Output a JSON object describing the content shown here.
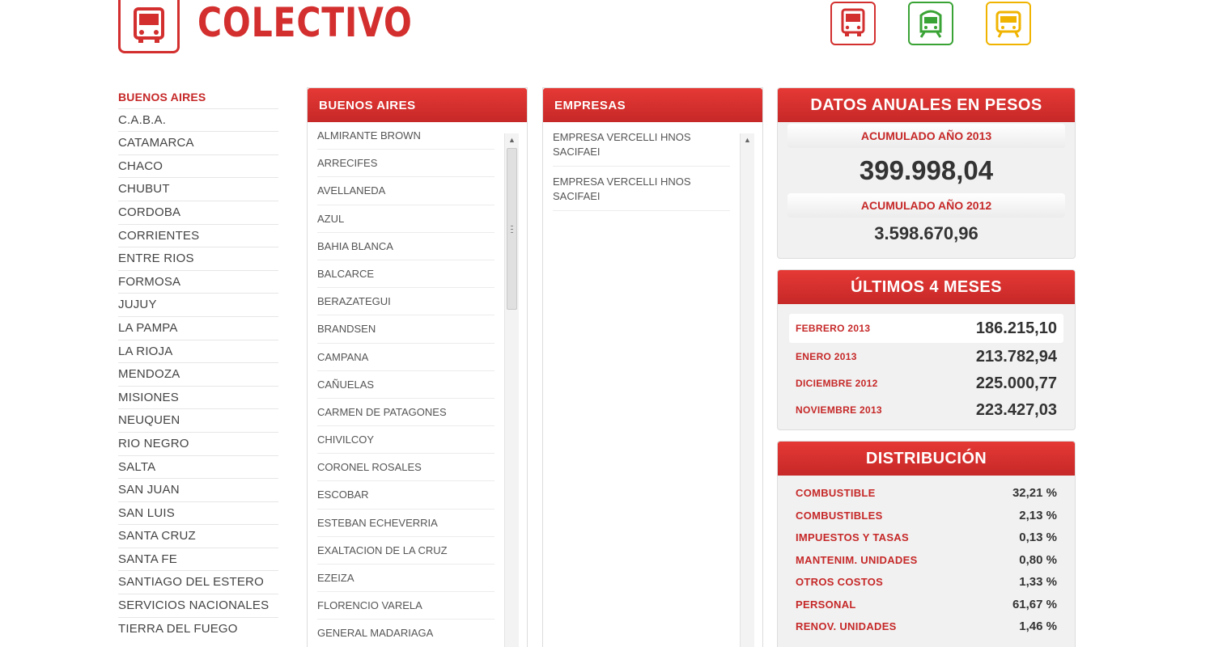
{
  "header": {
    "title": "COLECTIVO",
    "modes": [
      "bus-icon",
      "train-icon",
      "subway-icon"
    ]
  },
  "colors": {
    "accent": "#d32f2f",
    "train": "#3aa335",
    "subte": "#f0b400"
  },
  "provinces": [
    "BUENOS AIRES",
    "C.A.B.A.",
    "CATAMARCA",
    "CHACO",
    "CHUBUT",
    "CORDOBA",
    "CORRIENTES",
    "ENTRE RIOS",
    "FORMOSA",
    "JUJUY",
    "LA PAMPA",
    "LA RIOJA",
    "MENDOZA",
    "MISIONES",
    "NEUQUEN",
    "RIO NEGRO",
    "SALTA",
    "SAN JUAN",
    "SAN LUIS",
    "SANTA CRUZ",
    "SANTA FE",
    "SANTIAGO DEL ESTERO",
    "SERVICIOS NACIONALES",
    "TIERRA DEL FUEGO"
  ],
  "municipios": {
    "title": "BUENOS AIRES",
    "items": [
      "ALMIRANTE BROWN",
      "ARRECIFES",
      "AVELLANEDA",
      "AZUL",
      "BAHIA BLANCA",
      "BALCARCE",
      "BERAZATEGUI",
      "BRANDSEN",
      "CAMPANA",
      "CAÑUELAS",
      "CARMEN DE PATAGONES",
      "CHIVILCOY",
      "CORONEL ROSALES",
      "ESCOBAR",
      "ESTEBAN ECHEVERRIA",
      "EXALTACION DE LA CRUZ",
      "EZEIZA",
      "FLORENCIO VARELA",
      "GENERAL MADARIAGA"
    ]
  },
  "empresas": {
    "title": "EMPRESAS",
    "items": [
      "EMPRESA VERCELLI HNOS SACIFAEI",
      "EMPRESA VERCELLI HNOS SACIFAEI"
    ]
  },
  "datos_anuales": {
    "title": "DATOS ANUALES EN PESOS",
    "label_2013": "ACUMULADO AÑO 2013",
    "value_2013": "399.998,04",
    "label_2012": "ACUMULADO AÑO 2012",
    "value_2012": "3.598.670,96"
  },
  "ultimos_meses": {
    "title": "ÚLTIMOS 4 MESES",
    "rows": [
      {
        "label": "FEBRERO 2013",
        "value": "186.215,10"
      },
      {
        "label": "ENERO 2013",
        "value": "213.782,94"
      },
      {
        "label": "DICIEMBRE 2012",
        "value": "225.000,77"
      },
      {
        "label": "NOVIEMBRE 2013",
        "value": "223.427,03"
      }
    ]
  },
  "distribucion": {
    "title": "DISTRIBUCIÓN",
    "rows": [
      {
        "label": "COMBUSTIBLE",
        "value": "32,21 %"
      },
      {
        "label": "COMBUSTIBLES",
        "value": "2,13 %"
      },
      {
        "label": "IMPUESTOS Y TASAS",
        "value": "0,13 %"
      },
      {
        "label": "MANTENIM. UNIDADES",
        "value": "0,80 %"
      },
      {
        "label": "OTROS COSTOS",
        "value": "1,33 %"
      },
      {
        "label": "PERSONAL",
        "value": "61,67 %"
      },
      {
        "label": "RENOV. UNIDADES",
        "value": "1,46 %"
      }
    ]
  }
}
